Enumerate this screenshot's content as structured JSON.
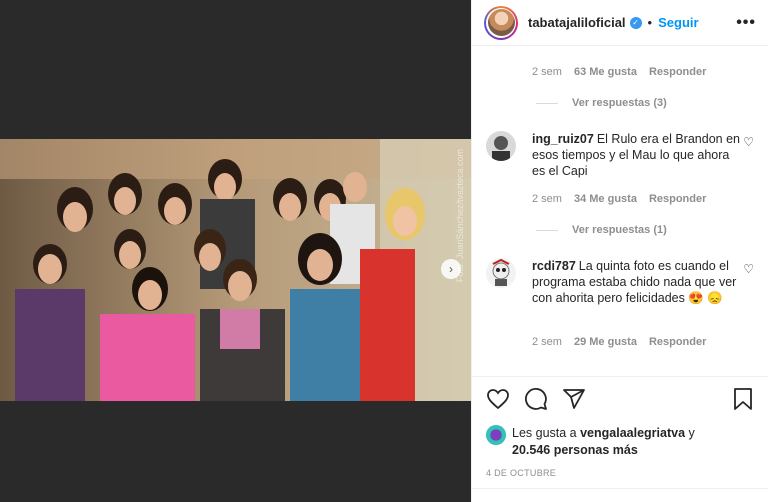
{
  "header": {
    "username": "tabatajaliloficial",
    "separator": "•",
    "follow_label": "Seguir",
    "more_label": "•••"
  },
  "photo": {
    "watermark": "Foto: JuanSánchez/tvazteca.com",
    "next_label": "›"
  },
  "comments": [
    {
      "type": "meta",
      "time": "2 sem",
      "likes": "63 Me gusta",
      "reply": "Responder"
    },
    {
      "type": "replies",
      "label": "Ver respuestas (3)"
    },
    {
      "type": "comment",
      "user": "ing_ruiz07",
      "text": "El Rulo era el Brandon en esos tiempos y el Mau lo que ahora es el Capi",
      "time": "2 sem",
      "likes": "34 Me gusta",
      "reply": "Responder",
      "replies": "Ver respuestas (1)"
    },
    {
      "type": "comment",
      "user": "rcdi787",
      "text": "La quinta foto es cuando el programa estaba chido nada que ver con ahorita pero felicidades 😍 😞",
      "time": "2 sem",
      "likes": "29 Me gusta",
      "reply": "Responder"
    }
  ],
  "actions": {
    "likes_prefix": "Les gusta a ",
    "likes_user": "vengalaalegriatva",
    "likes_mid": " y",
    "likes_count": "20.546 personas más",
    "date": "4 DE OCTUBRE"
  },
  "icons": [
    "heart-icon",
    "comment-icon",
    "share-icon",
    "bookmark-icon",
    "verified-icon",
    "chevron-right-icon",
    "more-icon"
  ],
  "colors": {
    "accent": "#0095f6",
    "text": "#262626",
    "muted": "#8e8e8e",
    "background_left": "#2a2a2a"
  }
}
